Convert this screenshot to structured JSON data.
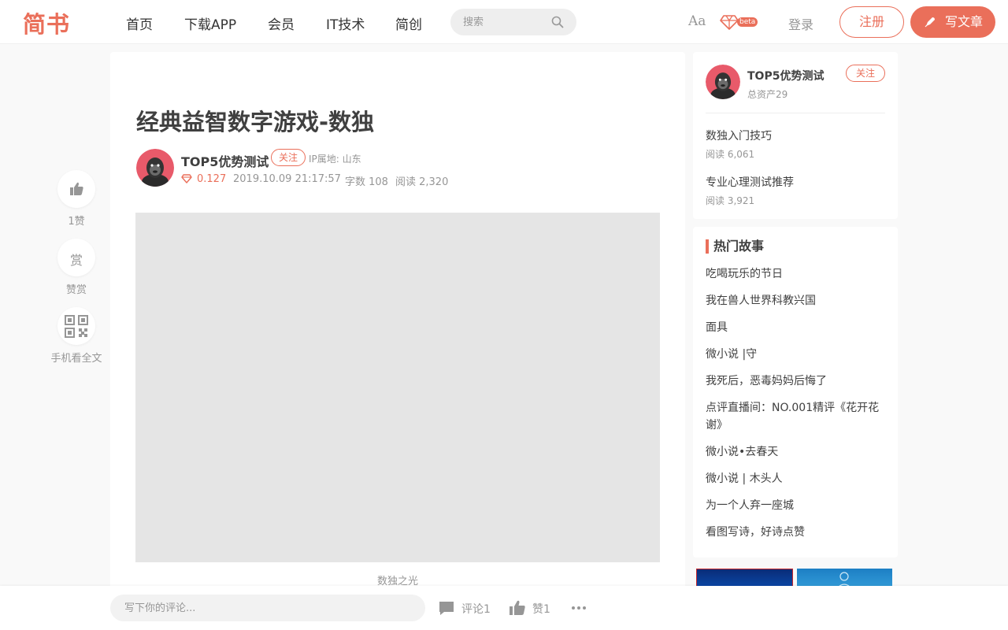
{
  "header": {
    "logo": "简书",
    "nav": [
      "首页",
      "下载APP",
      "会员",
      "IT技术",
      "简创"
    ],
    "search_placeholder": "搜索",
    "font_icon": "Aa",
    "beta": "beta",
    "login": "登录",
    "register": "注册",
    "write": "写文章"
  },
  "actions": {
    "like_label": "1赞",
    "reward_icon_text": "赏",
    "reward_label": "赞赏",
    "mobile_label": "手机看全文"
  },
  "article": {
    "title": "经典益智数字游戏-数独",
    "author": "TOP5优势测试",
    "follow": "关注",
    "ip": "IP属地: 山东",
    "assets": "0.127",
    "datetime": "2019.10.09 21:17:57",
    "word_count": "字数 108",
    "reads": "阅读 2,320",
    "image_caption": "数独之光"
  },
  "sidebar": {
    "author": {
      "name": "TOP5优势测试",
      "assets": "总资产29",
      "follow": "关注"
    },
    "posts": [
      {
        "title": "数独入门技巧",
        "reads": "阅读 6,061"
      },
      {
        "title": "专业心理测试推荐",
        "reads": "阅读 3,921"
      }
    ],
    "hot_title": "热门故事",
    "hot_stories": [
      "吃喝玩乐的节日",
      "我在兽人世界科教兴国",
      "面具",
      "微小说 |守",
      "我死后，恶毒妈妈后悔了",
      "点评直播间：NO.001精评《花开花谢》",
      "微小说•去春天",
      "微小说 | 木头人",
      "为一个人弃一座城",
      "看图写诗，好诗点赞"
    ]
  },
  "bottom": {
    "comment_placeholder": "写下你的评论...",
    "comments": "评论1",
    "likes": "赞1"
  },
  "colors": {
    "brand": "#ea6f5a",
    "text": "#404040",
    "muted": "#969696"
  }
}
